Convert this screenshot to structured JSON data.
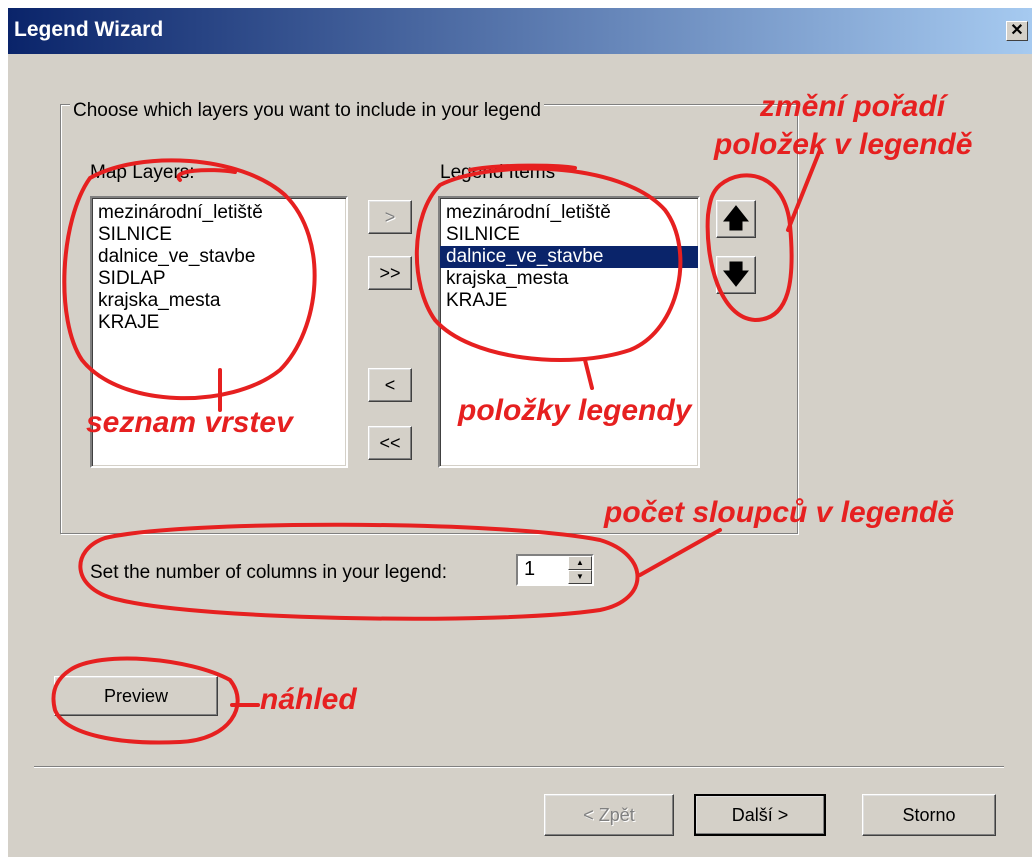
{
  "window": {
    "title": "Legend Wizard",
    "close_label": "✕"
  },
  "group": {
    "label": "Choose which layers you want to include in your legend"
  },
  "map_layers": {
    "label": "Map Layers:",
    "items": [
      "mezinárodní_letiště",
      "SILNICE",
      "dalnice_ve_stavbe",
      "SIDLAP",
      "krajska_mesta",
      "KRAJE"
    ]
  },
  "legend_items": {
    "label": "Legend Items",
    "items": [
      "mezinárodní_letiště",
      "SILNICE",
      "dalnice_ve_stavbe",
      "krajska_mesta",
      "KRAJE"
    ],
    "selected_item": "dalnice_ve_stavbe"
  },
  "transfer_buttons": {
    "add_one": ">",
    "add_all": ">>",
    "remove_one": "<",
    "remove_all": "<<"
  },
  "order_buttons": {
    "up_icon": "arrow-up-icon",
    "down_icon": "arrow-down-icon"
  },
  "columns": {
    "label": "Set the number of columns in your legend:",
    "value": "1"
  },
  "preview_label": "Preview",
  "footer": {
    "back_label": "< Zpět",
    "next_label": "Další >",
    "cancel_label": "Storno"
  },
  "annotations": {
    "reorder_line1": "změní pořadí",
    "reorder_line2": "položek v legendě",
    "layer_list": "seznam vrstev",
    "legend_items": "položky legendy",
    "column_count": "počet sloupců v legendě",
    "preview": "náhled"
  },
  "colors": {
    "dialog_bg": "#d4d0c8",
    "title_gradient_start": "#0a246a",
    "title_gradient_end": "#a6caf0",
    "selection": "#0a246a",
    "annotation_red": "#e62020"
  }
}
